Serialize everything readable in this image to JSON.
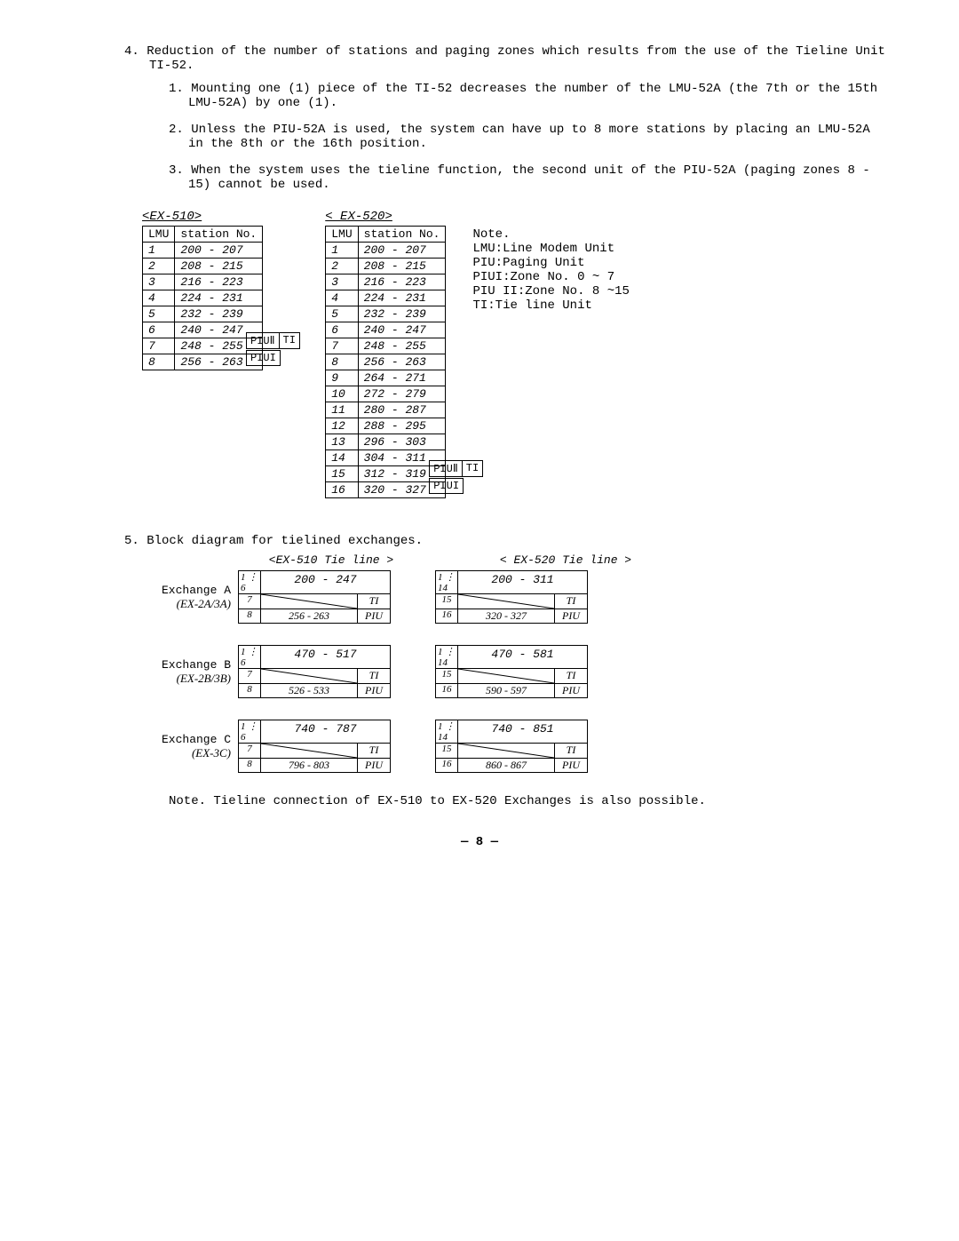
{
  "s4": {
    "num": "4.",
    "title": "Reduction of the number of stations and paging zones which results from the use of the Tieline Unit TI-52.",
    "items": [
      "1. Mounting one (1) piece of the TI-52 decreases the number of the LMU-52A (the 7th or the 15th LMU-52A) by one (1).",
      "2. Unless the PIU-52A is used, the system can have up to 8 more stations by placing an LMU-52A in the 8th or the 16th position.",
      "3. When the system uses the tieline function, the second unit of the PIU-52A (paging zones 8 - 15) cannot be used."
    ]
  },
  "table510": {
    "label": "<EX-510>",
    "hdr_l": "LMU",
    "hdr_r": "station No.",
    "rows": [
      [
        "1",
        "200 - 207"
      ],
      [
        "2",
        "208 - 215"
      ],
      [
        "3",
        "216 - 223"
      ],
      [
        "4",
        "224 - 231"
      ],
      [
        "5",
        "232 - 239"
      ],
      [
        "6",
        "240 - 247"
      ],
      [
        "7",
        "248 - 255"
      ],
      [
        "8",
        "256 - 263"
      ]
    ],
    "side7a": "PIUⅡ",
    "side7b": "TI",
    "side8": "PIUI"
  },
  "table520": {
    "label": "< EX-520>",
    "hdr_l": "LMU",
    "hdr_r": "station No.",
    "rows": [
      [
        "1",
        "200 - 207"
      ],
      [
        "2",
        "208 - 215"
      ],
      [
        "3",
        "216 - 223"
      ],
      [
        "4",
        "224 - 231"
      ],
      [
        "5",
        "232 - 239"
      ],
      [
        "6",
        "240 - 247"
      ],
      [
        "7",
        "248 - 255"
      ],
      [
        "8",
        "256 - 263"
      ],
      [
        "9",
        "264 - 271"
      ],
      [
        "10",
        "272 - 279"
      ],
      [
        "11",
        "280 - 287"
      ],
      [
        "12",
        "288 - 295"
      ],
      [
        "13",
        "296 - 303"
      ],
      [
        "14",
        "304 - 311"
      ],
      [
        "15",
        "312 - 319"
      ],
      [
        "16",
        "320 - 327"
      ]
    ],
    "side15a": "PIUⅡ",
    "side15b": "TI",
    "side16": "PIUI"
  },
  "notes": {
    "h": "Note.",
    "l": [
      "LMU:Line Modem Unit",
      "PIU:Paging Unit",
      "PIUI:Zone No. 0 ~ 7",
      "PIU II:Zone No. 8 ~15",
      "TI:Tie line Unit"
    ]
  },
  "s5": {
    "num": "5.",
    "title": "Block diagram for tielined exchanges.",
    "head_l": "<EX-510 Tie line >",
    "head_r": "< EX-520 Tie line >",
    "rows": [
      {
        "name": "Exchange A",
        "sub": "(EX-2A/3A)",
        "l_nums": "1\n⋮\n6",
        "l_range": "200 - 247",
        "l_m": "7",
        "l_ti": "TI",
        "l_b": "8",
        "l_brng": "256 - 263",
        "l_piu": "PIU",
        "r_nums": "1\n⋮\n14",
        "r_range": "200 - 311",
        "r_m": "15",
        "r_ti": "TI",
        "r_b": "16",
        "r_brng": "320 - 327",
        "r_piu": "PIU"
      },
      {
        "name": "Exchange B",
        "sub": "(EX-2B/3B)",
        "l_nums": "1\n⋮\n6",
        "l_range": "470 - 517",
        "l_m": "7",
        "l_ti": "TI",
        "l_b": "8",
        "l_brng": "526 - 533",
        "l_piu": "PIU",
        "r_nums": "1\n⋮\n14",
        "r_range": "470 - 581",
        "r_m": "15",
        "r_ti": "TI",
        "r_b": "16",
        "r_brng": "590 - 597",
        "r_piu": "PIU"
      },
      {
        "name": "Exchange C",
        "sub": "(EX-3C)",
        "l_nums": "1\n⋮\n6",
        "l_range": "740 - 787",
        "l_m": "7",
        "l_ti": "TI",
        "l_b": "8",
        "l_brng": "796 - 803",
        "l_piu": "PIU",
        "r_nums": "1\n⋮\n14",
        "r_range": "740 - 851",
        "r_m": "15",
        "r_ti": "TI",
        "r_b": "16",
        "r_brng": "860 - 867",
        "r_piu": "PIU"
      }
    ],
    "footnote": "Note. Tieline connection of EX-510 to EX-520 Exchanges is also possible."
  },
  "page": "— 8 —"
}
